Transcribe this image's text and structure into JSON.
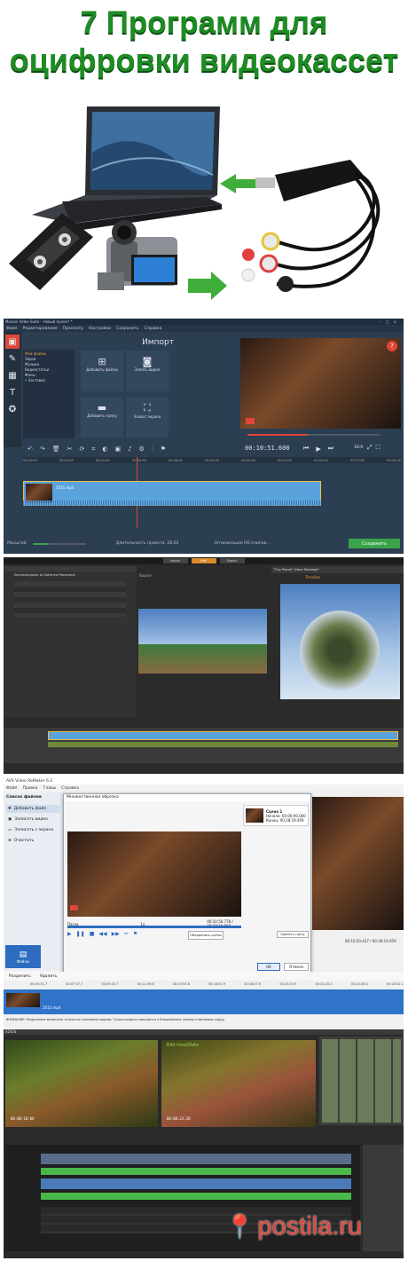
{
  "header": {
    "line1": "7 Программ для",
    "line2": "оцифровки видеокассет"
  },
  "colors": {
    "title_green": "#1e8c23",
    "movavi_bg": "#2c3e52",
    "save_green": "#3aa34a",
    "record_red": "#e0463a",
    "timeline_blue": "#5aa2dc"
  },
  "hardware": {
    "items": [
      "laptop",
      "usb-capture-adapter",
      "vhs-cassette",
      "camcorder",
      "arrow-left",
      "arrow-right"
    ]
  },
  "movavi": {
    "title": "Movavi Video Suite – Новый проект *",
    "menu": [
      "Файл",
      "Редактирование",
      "Просмотр",
      "Настройки",
      "Сохранить",
      "Справка"
    ],
    "import_title": "Импорт",
    "sources": [
      "Мои файлы",
      "Звуки",
      "Музыка",
      "Видеостатьи",
      "Фоны",
      "• Заставки"
    ],
    "tiles": [
      "Добавить файлы",
      "Запись видео",
      "Добавить папку",
      "Захват экрана"
    ],
    "timecode": "00:10:51.600",
    "aspect": "16:9",
    "clip_name": "2015.mp4",
    "ruler": [
      "00:00:00",
      "00:00:05",
      "00:01:00",
      "00:05:00",
      "00:06:00",
      "00:10:00",
      "00:15:00",
      "00:21:00",
      "00:23:00",
      "00:27:00",
      "00:30:00"
    ],
    "scale_label": "Масштаб:",
    "duration_label": "Длительность проекта: 28:20",
    "hd_label": "Оптимизация HD клипов...",
    "save_label": "Сохранить"
  },
  "pinnacle": {
    "tabs": [
      "Import",
      "Edit",
      "Export"
    ],
    "panel_title": "Equirectangular to Spherical Panorama",
    "player_title": "\"Tiny Planet\" Video Montage*",
    "left_label": "Source",
    "right_label": "Timeline"
  },
  "avs": {
    "title": "AVS Video ReMaker 6.2",
    "menu": [
      "Файл",
      "Правка",
      "Главы",
      "Справка"
    ],
    "files_label": "Список файлов",
    "actions": [
      "Добавить файл",
      "Записать видео",
      "Записать с экрана",
      "Очистить"
    ],
    "dialog_title": "Множественная обрезка",
    "scene_title": "Сцена 1",
    "scene_start": "Начало: 00:00:00.000",
    "scene_end": "Конец: 00:28:19.959",
    "pause_label": "Пауза",
    "speed_label": "1x",
    "dialog_time": "00:10:50.778 / 00:28:19.960",
    "combine_label": "Объединить сцены",
    "delete_label": "Удалить сцену",
    "ok_label": "OK",
    "cancel_label": "Отмена",
    "main_time": "00:10:50.437 / 00:28:19.959",
    "bottom_tools": [
      "Разделить",
      "Удалить"
    ],
    "ruler": [
      "00:05:31.7",
      "00:07:37.7",
      "00:09:43.7",
      "00:11:49.8",
      "00:13:55.8",
      "00:16:01.9",
      "00:18:07.9",
      "00:20:13.9",
      "00:22:20.0",
      "00:24:26.0",
      "00:26:32.1"
    ],
    "clip_name": "2015.mp4",
    "note": "ВНИМАНИЕ: Разделение возможно только по ключевым кадрам. Точка раздела смещается к ближайшему левому ключевому кадру.",
    "sidebar_tab": "Файлы"
  },
  "edius": {
    "title": "EDIUS",
    "left_overlay": "",
    "right_overlay": "Edit time/Date",
    "tc_left": "00:00:10;00",
    "tc_right": "00:00:23;20"
  },
  "watermark": "postila.ru"
}
